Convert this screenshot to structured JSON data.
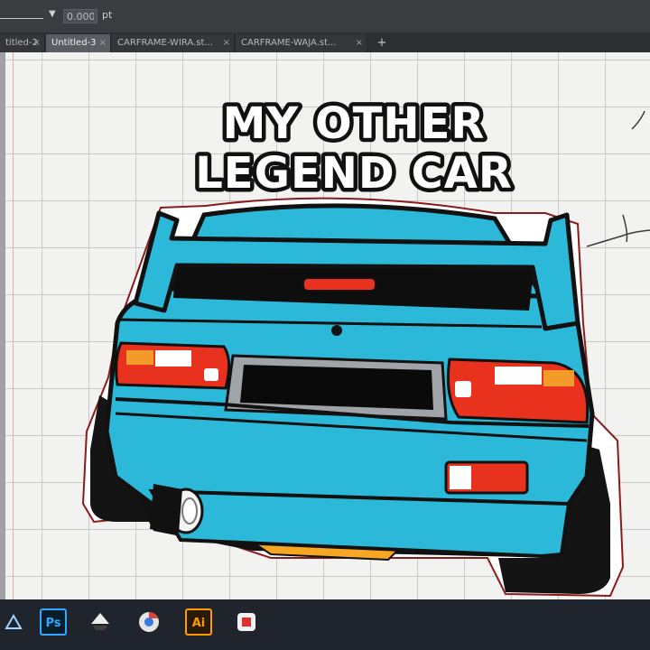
{
  "control_bar": {
    "stroke_value": "0.000",
    "stroke_unit": "pt"
  },
  "tabs": [
    {
      "label": "titled-2",
      "active": false
    },
    {
      "label": "Untitled-3",
      "active": true
    },
    {
      "label": "CARFRAME-WIRA.st...",
      "active": false
    },
    {
      "label": "CARFRAME-WAJA.st...",
      "active": false
    }
  ],
  "tab_close_glyph": "×",
  "tab_add_glyph": "+",
  "artwork": {
    "headline_line1": "MY OTHER",
    "headline_line2": "LEGEND CAR",
    "colors": {
      "body": "#2cb8d8",
      "outline": "#111111",
      "taillight": "#e8321e",
      "indicator": "#f29a2a",
      "plate_frame": "#a0a4a8",
      "exhaust_guard": "#f5a623",
      "red_rim": "#8b1a1a"
    }
  },
  "taskbar": {
    "ps_label": "Ps",
    "ai_label": "Ai",
    "icons": [
      "edge-icon",
      "photoshop-icon",
      "inkscape-icon",
      "chrome-icon",
      "illustrator-icon",
      "app-icon"
    ]
  }
}
